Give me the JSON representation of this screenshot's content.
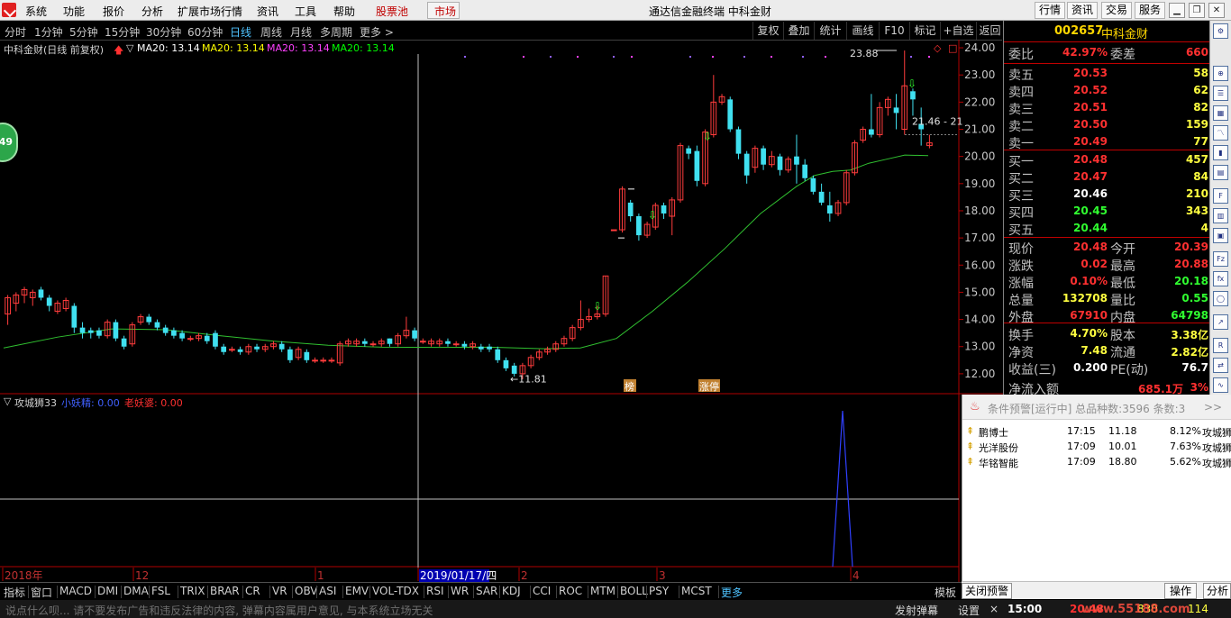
{
  "menu": {
    "items": [
      "系统",
      "功能",
      "报价",
      "分析",
      "扩展市场行情",
      "资讯",
      "工具",
      "帮助"
    ],
    "red_items": [
      "股票池",
      "市场"
    ],
    "title": "通达信金融终端  中科金财",
    "right_buttons": [
      "行情",
      "资讯",
      "交易",
      "服务"
    ]
  },
  "periods": [
    "分时",
    "1分钟",
    "5分钟",
    "15分钟",
    "30分钟",
    "60分钟",
    "日线",
    "周线",
    "月线",
    "多周期",
    "更多 >"
  ],
  "active_period": "日线",
  "tools": [
    "复权",
    "叠加",
    "统计",
    "画线",
    "F10",
    "标记",
    "+自选",
    "返回"
  ],
  "chart_header": {
    "name": "中科金财(日线 前复权)",
    "ma": [
      {
        "text": "MA20: 13.14",
        "color": "#ffffff"
      },
      {
        "text": "MA20: 13.14",
        "color": "#ffff00"
      },
      {
        "text": "MA20: 13.14",
        "color": "#ff40ff"
      },
      {
        "text": "MA20: 13.14",
        "color": "#00ff00"
      }
    ]
  },
  "indicator_header": {
    "name": "攻城狮33",
    "items": [
      {
        "text": "小妖精: 0.00",
        "color": "#4060ff"
      },
      {
        "text": "老妖婆: 0.00",
        "color": "#ff3030"
      }
    ]
  },
  "bubble": "49",
  "chart_data": {
    "type": "candlestick",
    "y_ticks": [
      "24.00",
      "23.00",
      "22.00",
      "21.00",
      "20.00",
      "19.00",
      "18.00",
      "17.00",
      "16.00",
      "15.00",
      "14.00",
      "13.00",
      "12.00"
    ],
    "ylim": [
      11.3,
      24.3
    ],
    "annotations": {
      "high": "23.88",
      "low": "11.81",
      "range": "21.46 - 21"
    },
    "x_labels": [
      "2018年",
      "12",
      "1",
      "2019/01/17/四",
      "2",
      "3",
      "4"
    ],
    "candles": [
      [
        14.2,
        14.8,
        13.8,
        14.9
      ],
      [
        14.6,
        14.9,
        14.3,
        15.0
      ],
      [
        14.9,
        15.1,
        14.6,
        15.2
      ],
      [
        14.8,
        15.0,
        14.5,
        15.1
      ],
      [
        15.1,
        14.8,
        14.7,
        15.2
      ],
      [
        14.8,
        14.5,
        14.3,
        14.9
      ],
      [
        14.3,
        14.6,
        14.2,
        14.7
      ],
      [
        14.4,
        14.7,
        14.3,
        14.8
      ],
      [
        14.5,
        13.7,
        13.5,
        14.6
      ],
      [
        13.7,
        13.5,
        13.3,
        13.9
      ],
      [
        13.6,
        13.5,
        13.3,
        13.7
      ],
      [
        13.6,
        13.4,
        13.3,
        13.7
      ],
      [
        13.4,
        13.9,
        13.3,
        14.0
      ],
      [
        13.9,
        13.3,
        13.2,
        14.0
      ],
      [
        13.3,
        13.0,
        12.9,
        13.4
      ],
      [
        13.1,
        13.8,
        13.0,
        13.9
      ],
      [
        13.9,
        14.1,
        13.8,
        14.2
      ],
      [
        14.1,
        13.9,
        13.8,
        14.2
      ],
      [
        13.9,
        13.7,
        13.6,
        14.0
      ],
      [
        13.7,
        13.5,
        13.4,
        13.8
      ],
      [
        13.6,
        13.4,
        13.3,
        13.7
      ],
      [
        13.5,
        13.3,
        13.2,
        13.6
      ],
      [
        13.3,
        13.3,
        13.2,
        13.4
      ],
      [
        13.3,
        13.4,
        13.2,
        13.5
      ],
      [
        13.4,
        13.2,
        13.1,
        13.5
      ],
      [
        13.5,
        13.0,
        12.9,
        13.6
      ],
      [
        13.0,
        12.8,
        12.7,
        13.1
      ],
      [
        12.9,
        12.9,
        12.8,
        13.0
      ],
      [
        12.9,
        12.8,
        12.7,
        13.0
      ],
      [
        12.8,
        13.0,
        12.7,
        13.1
      ],
      [
        13.0,
        12.9,
        12.8,
        13.1
      ],
      [
        12.9,
        13.0,
        12.8,
        13.1
      ],
      [
        13.0,
        13.1,
        12.9,
        13.2
      ],
      [
        13.1,
        12.9,
        12.8,
        13.2
      ],
      [
        12.9,
        12.5,
        12.4,
        13.0
      ],
      [
        12.6,
        12.9,
        12.5,
        13.0
      ],
      [
        12.8,
        12.5,
        12.4,
        12.9
      ],
      [
        12.5,
        12.5,
        12.4,
        12.6
      ],
      [
        12.5,
        12.5,
        12.4,
        12.6
      ],
      [
        12.5,
        12.5,
        12.4,
        12.6
      ],
      [
        12.4,
        13.1,
        12.3,
        13.2
      ],
      [
        13.1,
        13.2,
        13.0,
        13.3
      ],
      [
        13.1,
        13.2,
        13.0,
        13.3
      ],
      [
        13.2,
        13.1,
        13.0,
        13.3
      ],
      [
        13.1,
        13.1,
        13.0,
        13.2
      ],
      [
        13.1,
        13.2,
        13.0,
        13.3
      ],
      [
        13.3,
        13.1,
        13.0,
        13.3
      ],
      [
        13.1,
        13.4,
        13.0,
        13.5
      ],
      [
        13.4,
        13.6,
        13.3,
        14.1
      ],
      [
        13.6,
        13.3,
        13.2,
        13.7
      ],
      [
        13.2,
        13.2,
        13.1,
        13.3
      ],
      [
        13.1,
        13.2,
        13.0,
        13.3
      ],
      [
        13.1,
        13.2,
        13.0,
        13.3
      ],
      [
        13.2,
        13.1,
        13.0,
        13.3
      ],
      [
        13.1,
        13.1,
        13.0,
        13.2
      ],
      [
        13.1,
        13.0,
        12.9,
        13.2
      ],
      [
        13.0,
        13.1,
        12.9,
        13.2
      ],
      [
        13.0,
        12.9,
        12.8,
        13.1
      ],
      [
        13.0,
        12.9,
        12.8,
        13.1
      ],
      [
        12.9,
        12.5,
        12.4,
        13.0
      ],
      [
        12.5,
        12.2,
        12.1,
        12.6
      ],
      [
        12.3,
        12.0,
        11.9,
        12.4
      ],
      [
        12.0,
        12.3,
        11.8,
        12.4
      ],
      [
        12.3,
        12.6,
        12.2,
        12.7
      ],
      [
        12.6,
        12.8,
        12.5,
        12.9
      ],
      [
        12.8,
        12.9,
        12.7,
        13.0
      ],
      [
        12.9,
        13.1,
        12.8,
        13.2
      ],
      [
        13.1,
        13.3,
        13.0,
        13.4
      ],
      [
        13.3,
        13.7,
        13.2,
        13.8
      ],
      [
        13.7,
        14.0,
        13.6,
        14.7
      ],
      [
        14.0,
        14.1,
        13.9,
        14.4
      ],
      [
        14.1,
        14.2,
        14.0,
        14.5
      ],
      [
        14.2,
        15.6,
        14.1,
        15.6
      ],
      [
        17.3,
        17.3,
        17.3,
        17.3
      ],
      [
        17.3,
        18.8,
        17.2,
        18.9
      ],
      [
        18.3,
        17.8,
        17.6,
        18.4
      ],
      [
        17.8,
        17.1,
        16.9,
        17.9
      ],
      [
        17.1,
        17.5,
        17.0,
        17.6
      ],
      [
        17.4,
        18.2,
        17.3,
        18.3
      ],
      [
        18.2,
        17.9,
        17.7,
        18.3
      ],
      [
        17.8,
        18.4,
        17.1,
        18.5
      ],
      [
        18.4,
        20.4,
        18.3,
        20.5
      ],
      [
        20.3,
        20.1,
        19.9,
        20.4
      ],
      [
        20.2,
        19.1,
        18.9,
        20.4
      ],
      [
        19.0,
        20.9,
        18.9,
        21.0
      ],
      [
        20.8,
        22.0,
        20.7,
        23.0
      ],
      [
        22.0,
        22.2,
        21.9,
        22.3
      ],
      [
        22.1,
        21.0,
        20.9,
        22.2
      ],
      [
        21.0,
        20.1,
        19.9,
        21.1
      ],
      [
        20.1,
        19.3,
        19.0,
        20.2
      ],
      [
        19.6,
        20.3,
        19.4,
        20.4
      ],
      [
        20.3,
        19.7,
        19.5,
        20.4
      ],
      [
        19.7,
        20.0,
        19.6,
        20.2
      ],
      [
        20.0,
        19.5,
        19.3,
        20.1
      ],
      [
        19.5,
        19.9,
        19.4,
        20.0
      ],
      [
        20.0,
        19.7,
        19.0,
        20.8
      ],
      [
        19.7,
        19.2,
        19.1,
        19.9
      ],
      [
        19.2,
        18.7,
        18.6,
        19.3
      ],
      [
        18.7,
        18.3,
        18.2,
        19.0
      ],
      [
        18.2,
        17.9,
        17.6,
        18.7
      ],
      [
        17.9,
        18.3,
        17.8,
        18.4
      ],
      [
        18.3,
        19.4,
        18.2,
        19.5
      ],
      [
        19.4,
        20.5,
        19.3,
        20.6
      ],
      [
        20.6,
        21.0,
        20.5,
        21.1
      ],
      [
        21.0,
        20.8,
        20.7,
        22.3
      ],
      [
        20.8,
        21.8,
        20.7,
        22.0
      ],
      [
        21.8,
        22.1,
        21.5,
        22.2
      ],
      [
        21.8,
        21.6,
        21.0,
        22.3
      ],
      [
        21.0,
        22.6,
        20.8,
        23.9
      ],
      [
        22.4,
        22.1,
        21.5,
        22.5
      ],
      [
        21.2,
        21.0,
        20.4,
        21.8
      ],
      [
        20.4,
        20.5,
        20.3,
        20.8
      ]
    ],
    "ma20": [
      [
        0,
        12.95
      ],
      [
        60,
        13.35
      ],
      [
        120,
        13.65
      ],
      [
        180,
        13.62
      ],
      [
        240,
        13.4
      ],
      [
        300,
        13.2
      ],
      [
        360,
        13.05
      ],
      [
        420,
        12.98
      ],
      [
        480,
        12.97
      ],
      [
        540,
        12.98
      ],
      [
        600,
        12.92
      ],
      [
        640,
        12.95
      ],
      [
        680,
        13.3
      ],
      [
        720,
        14.3
      ],
      [
        760,
        15.4
      ],
      [
        800,
        16.6
      ],
      [
        840,
        17.9
      ],
      [
        880,
        18.9
      ],
      [
        900,
        19.3
      ],
      [
        920,
        19.45
      ],
      [
        940,
        19.5
      ],
      [
        960,
        19.75
      ],
      [
        980,
        19.9
      ],
      [
        1000,
        20.05
      ],
      [
        1026,
        20.03
      ]
    ]
  },
  "right_panel": {
    "code": "002657",
    "name": "中科金财",
    "weibi": {
      "label": "委比",
      "value": "42.97%",
      "label2": "委差",
      "value2": "660"
    },
    "sells": [
      {
        "label": "卖五",
        "price": "20.53",
        "vol": "58"
      },
      {
        "label": "卖四",
        "price": "20.52",
        "vol": "62"
      },
      {
        "label": "卖三",
        "price": "20.51",
        "vol": "82"
      },
      {
        "label": "卖二",
        "price": "20.50",
        "vol": "159"
      },
      {
        "label": "卖一",
        "price": "20.49",
        "vol": "77"
      }
    ],
    "buys": [
      {
        "label": "买一",
        "price": "20.48",
        "vol": "457"
      },
      {
        "label": "买二",
        "price": "20.47",
        "vol": "84"
      },
      {
        "label": "买三",
        "price": "20.46",
        "vol": "210"
      },
      {
        "label": "买四",
        "price": "20.45",
        "vol": "343"
      },
      {
        "label": "买五",
        "price": "20.44",
        "vol": "4"
      }
    ],
    "stats": [
      {
        "l1": "现价",
        "v1": "20.48",
        "c1": "#ff3030",
        "l2": "今开",
        "v2": "20.39",
        "c2": "#ff3030"
      },
      {
        "l1": "涨跌",
        "v1": "0.02",
        "c1": "#ff3030",
        "l2": "最高",
        "v2": "20.88",
        "c2": "#ff3030"
      },
      {
        "l1": "涨幅",
        "v1": "0.10%",
        "c1": "#ff3030",
        "l2": "最低",
        "v2": "20.18",
        "c2": "#30ff30"
      },
      {
        "l1": "总量",
        "v1": "132708",
        "c1": "#ffff40",
        "l2": "量比",
        "v2": "0.55",
        "c2": "#30ff30"
      },
      {
        "l1": "外盘",
        "v1": "67910",
        "c1": "#ff3030",
        "l2": "内盘",
        "v2": "64798",
        "c2": "#30ff30"
      }
    ],
    "stats2": [
      {
        "l1": "换手",
        "v1": "4.70%",
        "c1": "#ffff40",
        "l2": "股本",
        "v2": "3.38亿",
        "c2": "#ffff40"
      },
      {
        "l1": "净资",
        "v1": "7.48",
        "c1": "#ffff40",
        "l2": "流通",
        "v2": "2.82亿",
        "c2": "#ffff40"
      },
      {
        "l1": "收益(三)",
        "v1": "0.200",
        "c1": "#ffffff",
        "l2": "PE(动)",
        "v2": "76.7",
        "c2": "#ffffff"
      }
    ],
    "net_inflow": {
      "label": "净流入额",
      "value": "685.1万",
      "pct": "3%"
    }
  },
  "alert": {
    "title": "条件预警[运行中] 总品种数:3596 条数:3",
    "more": ">>",
    "rows": [
      {
        "name": "鹏博士",
        "time": "17:15",
        "price": "11.18",
        "pct": "8.12%",
        "strategy": "攻城狮"
      },
      {
        "name": "光洋股份",
        "time": "17:09",
        "price": "10.01",
        "pct": "7.63%",
        "strategy": "攻城狮"
      },
      {
        "name": "华铭智能",
        "time": "17:09",
        "price": "18.80",
        "pct": "5.62%",
        "strategy": "攻城狮"
      }
    ],
    "close_btn": "关闭预警",
    "op_btn": "操作",
    "analysis_btn": "分析"
  },
  "indicator_tabs": [
    "指标",
    "窗口",
    "MACD",
    "DMI",
    "DMA",
    "FSL",
    "TRIX",
    "BRAR",
    "CR",
    "VR",
    "OBV",
    "ASI",
    "EMV",
    "VOL-TDX",
    "RSI",
    "WR",
    "SAR",
    "KDJ",
    "CCI",
    "ROC",
    "MTM",
    "BOLL",
    "PSY",
    "MCST",
    "更多"
  ],
  "active_tab": "更多",
  "template_tab": "模板",
  "status": {
    "message": "说点什么呗...  请不要发布广告和违反法律的内容, 弹幕内容属用户意见, 与本系统立场无关",
    "danmu": "发射弹幕",
    "settings": "设置",
    "close": "×",
    "time": "15:00",
    "price": "20.48",
    "vol": "830",
    "lot": "114",
    "watermark": "www.55188.com"
  },
  "labels": {
    "bang": "榜",
    "zhangting": "涨停"
  }
}
